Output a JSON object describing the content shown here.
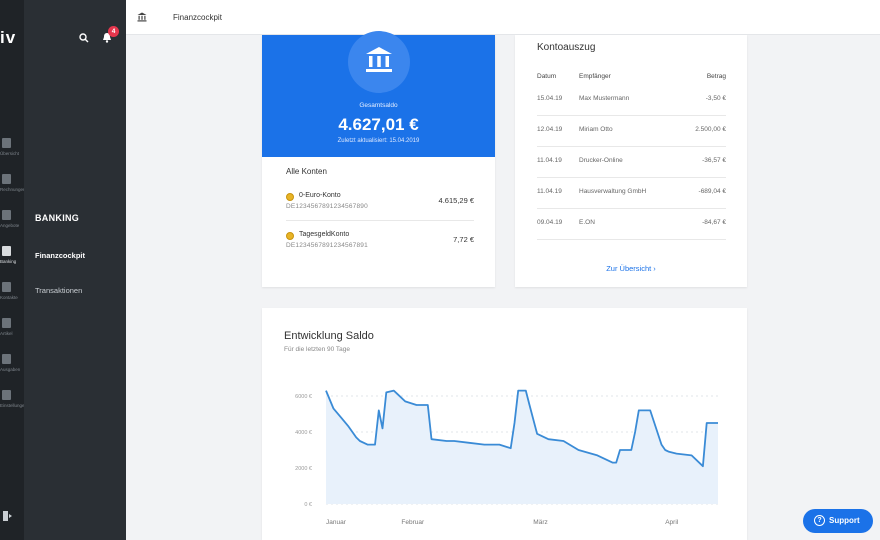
{
  "brand": "iv",
  "notifications": {
    "count": "4"
  },
  "rail": [
    {
      "icon": "dashboard-icon",
      "label": "Übersicht"
    },
    {
      "icon": "documents-icon",
      "label": "Rechnungen"
    },
    {
      "icon": "offers-icon",
      "label": "Angebote"
    },
    {
      "icon": "bank-icon",
      "label": "Banking"
    },
    {
      "icon": "contacts-icon",
      "label": "Kontakte"
    },
    {
      "icon": "tag-icon",
      "label": "Artikel"
    },
    {
      "icon": "expenses-icon",
      "label": "Ausgaben"
    },
    {
      "icon": "settings-icon",
      "label": "Einstellungen"
    }
  ],
  "sidebar": {
    "section": "BANKING",
    "items": [
      "Finanzcockpit",
      "Transaktionen"
    ]
  },
  "topbar": {
    "title": "Finanzcockpit"
  },
  "balance": {
    "label": "Gesamtsaldo",
    "value": "4.627,01 €",
    "updated": "Zuletzt aktualisiert: 15.04.2019"
  },
  "accounts": {
    "title": "Alle Konten",
    "items": [
      {
        "name": "0-Euro-Konto",
        "iban": "DE12345678912345678​90",
        "amount": "4.615,29 €"
      },
      {
        "name": "TagesgeldKonto",
        "iban": "DE12345678912345678​91",
        "amount": "7,72 €"
      }
    ]
  },
  "statement": {
    "title": "Kontoauszug",
    "headers": {
      "date": "Datum",
      "recipient": "Empfänger",
      "amount": "Betrag"
    },
    "rows": [
      {
        "date": "15.04.19",
        "recipient": "Max Mustermann",
        "amount": "-3,50 €"
      },
      {
        "date": "12.04.19",
        "recipient": "Miriam Otto",
        "amount": "2.500,00 €"
      },
      {
        "date": "11.04.19",
        "recipient": "Drucker-Online",
        "amount": "-36,57 €"
      },
      {
        "date": "11.04.19",
        "recipient": "Hausverwaltung GmbH",
        "amount": "-689,04 €"
      },
      {
        "date": "09.04.19",
        "recipient": "E.ON",
        "amount": "-84,67 €"
      }
    ],
    "link": "Zur Übersicht"
  },
  "chart_data": {
    "type": "line",
    "title": "Entwicklung Saldo",
    "subtitle": "Für die letzten 90 Tage",
    "ylim": [
      0,
      6000
    ],
    "yticks": [
      0,
      2000,
      4000,
      6000
    ],
    "ytick_labels": [
      "0 €",
      "2000 €",
      "4000 €",
      "6000 €"
    ],
    "xlim": [
      0,
      104
    ],
    "xticks": [
      {
        "x": 0,
        "label": "Januar"
      },
      {
        "x": 20,
        "label": "Februar"
      },
      {
        "x": 55,
        "label": "März"
      },
      {
        "x": 90,
        "label": "April"
      }
    ],
    "grid": true,
    "color": "#3a8bd6",
    "series": [
      {
        "x": [
          0,
          2,
          4,
          6,
          8,
          9,
          11,
          13,
          14,
          15,
          16,
          18,
          19,
          21,
          24,
          26,
          27,
          28,
          32,
          33,
          34,
          38,
          42,
          46,
          49,
          50,
          51,
          52,
          53,
          54,
          56,
          59,
          63,
          67,
          72,
          76,
          77,
          78,
          80,
          81,
          82,
          83,
          86,
          89,
          90,
          91,
          93,
          97,
          100,
          101,
          102,
          104
        ],
        "y": [
          6300,
          5300,
          4800,
          4300,
          3700,
          3500,
          3300,
          3300,
          5200,
          4200,
          6200,
          6300,
          6100,
          5700,
          5500,
          5500,
          5500,
          3600,
          3500,
          3500,
          3500,
          3400,
          3300,
          3300,
          3100,
          4500,
          6300,
          6300,
          6300,
          5500,
          3900,
          3600,
          3500,
          3000,
          2700,
          2300,
          2300,
          3000,
          3000,
          3000,
          4000,
          5200,
          5200,
          3300,
          3000,
          2900,
          2800,
          2700,
          2100,
          4500,
          4500,
          4500
        ]
      }
    ]
  }
}
